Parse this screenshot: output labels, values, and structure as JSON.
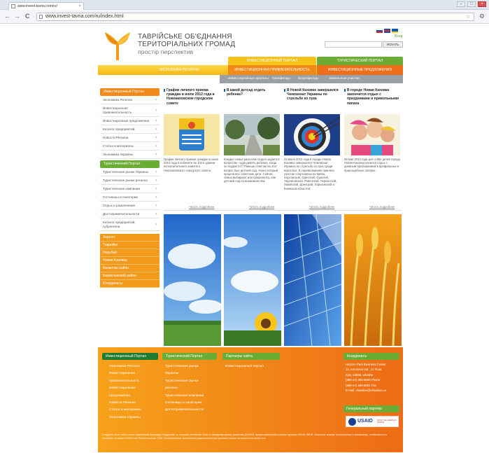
{
  "browser": {
    "tab_title": "www.invest-tavria.com/ru/",
    "tab_close": "×",
    "address": "www.invest-tavria.com/ru/index.html",
    "back": "←",
    "forward": "→",
    "reload": "C",
    "star": "☆",
    "wrench": "⚙",
    "win_min": "–",
    "win_max": "□",
    "win_close": "×"
  },
  "header": {
    "brand_line1": "ТАВРІЙСЬКЕ ОБ'ЄДНАННЯ",
    "brand_line2": "ТЕРИТОРІАЛЬНИХ ГРОМАД",
    "tagline": "простір перспектив",
    "login": "Вход",
    "search_placeholder": "",
    "search_button": "ИСКАТЬ",
    "flag_colors": [
      [
        "#ffffff",
        "#1b4db3",
        "#d52b1e"
      ],
      [
        "#1b4db3",
        "#d52b1e",
        "#1b4db3"
      ],
      [
        "#0057b7",
        "#0057b7",
        "#ffd700"
      ]
    ]
  },
  "nav": {
    "tab_invest": "ИНВЕСТИЦИОННЫЙ ПОРТАЛ",
    "tab_tourism": "ТУРИСТИЧЕСКИЙ ПОРТАЛ",
    "primary": [
      "ЭКОНОМИКА РЕГИОНА",
      "ИНВЕСТИЦИОННАЯ ПРИВЛЕКАТЕЛЬНОСТЬ",
      "ИНВЕСТИЦИОННЫЕ ПРЕДЛОЖЕНИЯ"
    ],
    "secondary": [
      "Инвестиционные проекты",
      "Гринфилды",
      "Браунфилды",
      "Земельные участки"
    ]
  },
  "sidebar": {
    "head": "Инвестиционный Портал",
    "items": [
      "Экономика Региона",
      "Инвестиционная привлекательность",
      "Инвестиционные предложения",
      "Каталог предприятий",
      "Новости Региона",
      "Статьи и материалы",
      "Экономика Украины"
    ],
    "tourism_head": "Туристический Портал",
    "tourism_items": [
      "Туристические рынки Украины",
      "Туристические рынки региона",
      "Туристические компании",
      "Гостиницы и санатории",
      "Отдых и развлечения",
      "Достопримечательности",
      "Каталог предприятий субрегиона"
    ],
    "cities": [
      "Херсон",
      "Таврийск",
      "Нерубай",
      "Новая Каховка",
      "Каланчак район",
      "Бериславский район",
      "Координаты"
    ],
    "arrow": "›"
  },
  "news": [
    {
      "title": "График личного приема граждан в июле 2012 года в Новокаховском городском совете",
      "text": "График личного приема граждан в июле 2012 года в кабинете № 103 в здании исполнительного комитета Новокаховского городского совета.",
      "more": "Читать подробнее"
    },
    {
      "title": "В какой детсад отдать ребенка?",
      "text": "Каждая семья рано или поздно задается вопросом - куда девать ребенка, когда он подрастет? Раньше ответом на этот вопрос был детский сад, через который прошли все советские дети. Сейчас семьи выбирают или гувернантку, или детский сад по возможностям.",
      "more": "Читать подробнее"
    },
    {
      "title": "В Новой Каховке завершился Чемпионат Украины по стрельбе из лука",
      "text": "23 июня 2012 года в городе Новая Каховка завершился Чемпионат Украины по стрельбе из лука среди взрослых. В соревнованиях приняли участие спортсмены из Киева, Херсонской, Одесской, Сумской, Черниговской, Ровенской, Черкасской, Львовской, Донецкой, Харьковской и Киевской областей.",
      "more": "Читать подробнее"
    },
    {
      "title": "В городе Новая Каховка закончится отдых с праздниками и привольными папаха",
      "text": "28 мая 2012 года для 1 682 детей города Новая Каховка начался отдых с дневным пребыванием в профильных и приусадебных лагерях.",
      "more": "Читать подробнее"
    }
  ],
  "footer": {
    "col1_head": "Инвестиционный Портал",
    "col1_items": [
      "Экономика Региона",
      "Инвестиционная",
      "привлекательность",
      "Инвестиционные",
      "предложения",
      "Новости Региона",
      "Статьи и материалы",
      "Экономика Украины"
    ],
    "col2_head": "Туристический Портал",
    "col2_items": [
      "Туристические рынки",
      "Украины",
      "Туристические рынки",
      "региона",
      "Туристические компании",
      "Гостиницы и санатории",
      "Достопримечательности"
    ],
    "col3_head": "Партнеры сайта",
    "col3_items": [
      "Инвестиционный портал"
    ],
    "contacts_head": "Координаты",
    "contacts": [
      "Horizon Park Business Center",
      "12, Amosova Vul., 13 Floor",
      "Kyiv, 03680, Ukraine",
      "(380-44) 490-5800 Phone",
      "(380-44) 490-5801 Fax",
      "E-mail: chamber@chamber.ua"
    ],
    "partner_head": "Генеральный партнер",
    "usaid": "USAID",
    "usaid_sub": "FROM THE AMERICAN PEOPLE",
    "disclaimer": "Создание этого сайта стало возможным благодаря поддержке со стороны Агентства США по международному развитию (USAID), предоставленной в рамках проекта USAID ЛИНК. Открытые знания, высказанные в материалах, необязательно отражают позицию USAID или Правительства США. Использование материалов разрешается при условии ссылки на www.invest-tavria.com"
  }
}
